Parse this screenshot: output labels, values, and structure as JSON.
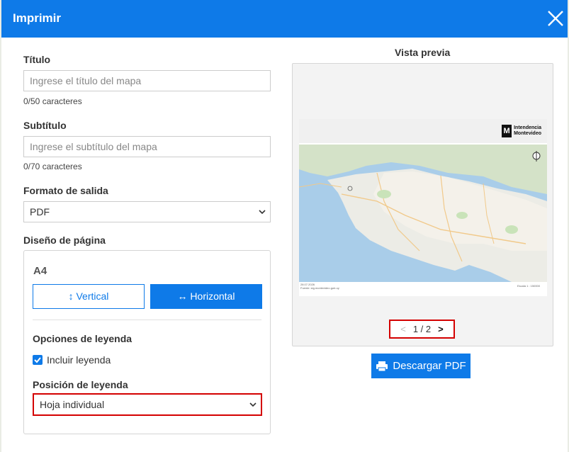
{
  "header": {
    "title": "Imprimir",
    "close_icon": "close-icon"
  },
  "form": {
    "title_label": "Título",
    "title_placeholder": "Ingrese el título del mapa",
    "title_counter": "0/50 caracteres",
    "subtitle_label": "Subtítulo",
    "subtitle_placeholder": "Ingrese el subtítulo del mapa",
    "subtitle_counter": "0/70 caracteres",
    "format_label": "Formato de salida",
    "format_value": "PDF",
    "layout_label": "Diseño de página",
    "paper_size": "A4",
    "orientation_vertical": "Vertical",
    "orientation_horizontal": "Horizontal",
    "legend_options_label": "Opciones de leyenda",
    "include_legend_label": "Incluir leyenda",
    "include_legend_checked": true,
    "legend_position_label": "Posición de leyenda",
    "legend_position_value": "Hoja individual"
  },
  "preview": {
    "title": "Vista previa",
    "logo_line1": "Intendencia",
    "logo_line2": "Montevideo",
    "logo_mark": "M",
    "footer_date": "28.07.2026",
    "footer_source": "Fuente: sig.montevideo.gub.uy",
    "scale_text": "Escala 1 : 150000",
    "page_indicator": "1 / 2",
    "prev": "<",
    "next": ">"
  },
  "actions": {
    "download_label": "Descargar PDF"
  },
  "colors": {
    "accent": "#0e7ae8",
    "highlight": "#d40000"
  }
}
